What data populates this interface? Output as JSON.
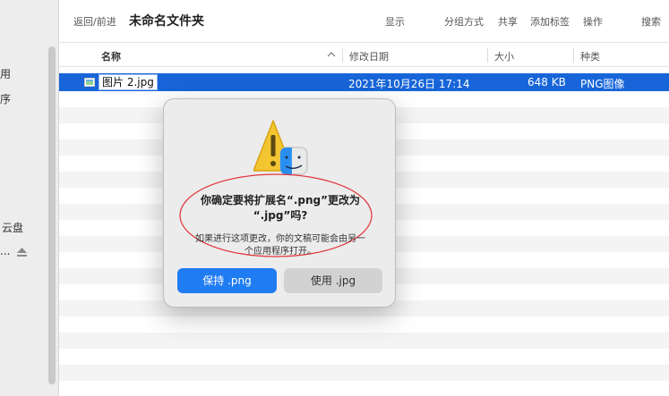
{
  "sidebar": {
    "items": [
      {
        "label": "用",
        "top": 0
      },
      {
        "label": "序",
        "top": 0
      },
      {
        "label": "云盘",
        "top": 0
      },
      {
        "label": "..."
      }
    ]
  },
  "toolbar": {
    "back_forward": "返回/前进",
    "title": "未命名文件夹",
    "view": "显示",
    "group": "分组方式",
    "share": "共享",
    "tags": "添加标签",
    "action": "操作",
    "search": "搜索"
  },
  "columns": {
    "name": "名称",
    "date": "修改日期",
    "size": "大小",
    "kind": "种类"
  },
  "file": {
    "name": "图片 2.jpg",
    "date": "2021年10月26日 17:14",
    "size": "648 KB",
    "kind": "PNG图像"
  },
  "dialog": {
    "title_line1": "你确定要将扩展名“.png”更改为",
    "title_line2": "“.jpg”吗?",
    "message_line1": "如果进行这项更改，你的文稿可能会由另一",
    "message_line2": "个应用程序打开。",
    "keep_button": "保持 .png",
    "use_button": "使用 .jpg"
  },
  "colors": {
    "selection": "#1765d8",
    "primary_button": "#1f7cf2",
    "annotation": "#e0353a"
  }
}
